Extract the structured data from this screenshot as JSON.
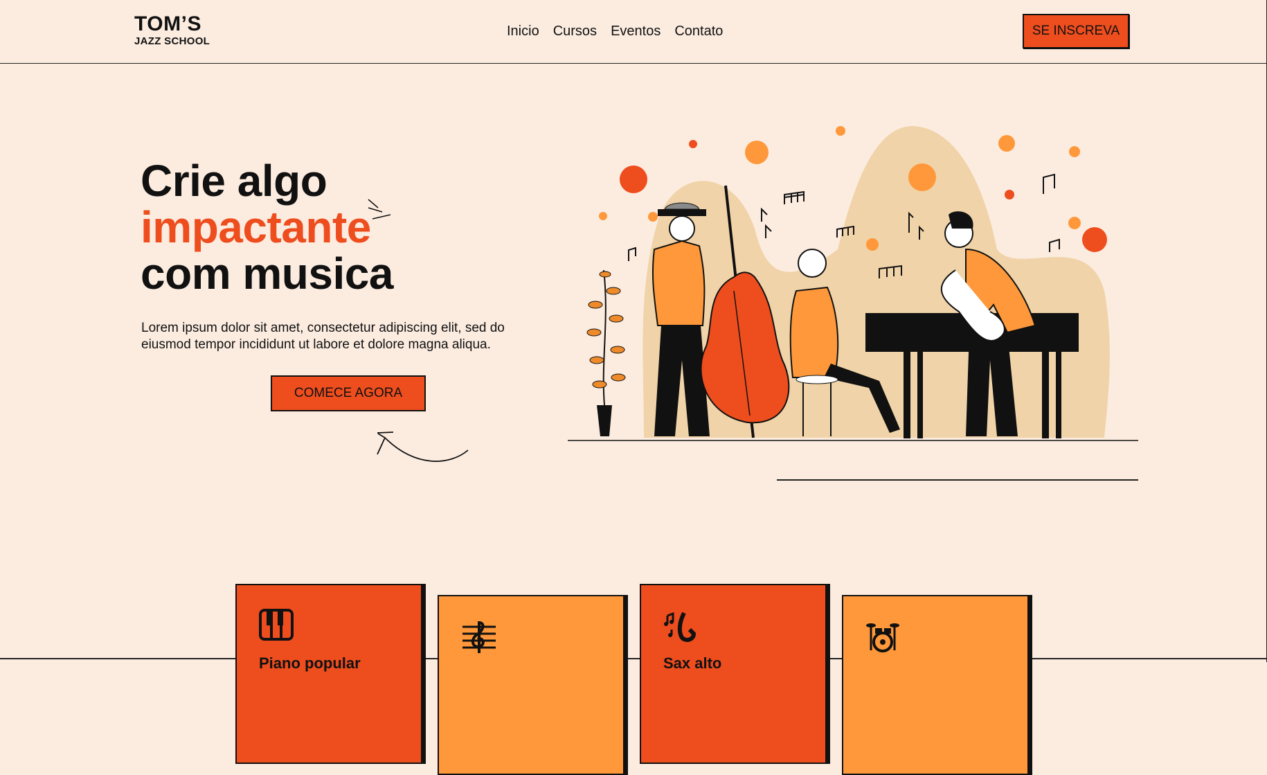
{
  "brand": {
    "title": "TOM’S",
    "subtitle": "JAZZ SCHOOL"
  },
  "nav": {
    "items": [
      "Inicio",
      "Cursos",
      "Eventos",
      "Contato"
    ]
  },
  "header": {
    "signup_label": "SE INSCREVA"
  },
  "hero": {
    "title_line1": "Crie algo",
    "title_line2": "impactante",
    "title_line3": "com musica",
    "description": "Lorem ipsum dolor sit amet, consectetur adipiscing elit, sed do eiusmod tempor incididunt ut labore et dolore magna aliqua.",
    "cta_label": "COMECE AGORA"
  },
  "cards": [
    {
      "label": "Piano popular",
      "icon": "piano-icon",
      "color": "#ee4d1e"
    },
    {
      "label": "",
      "icon": "treble-clef-icon",
      "color": "#fe983a"
    },
    {
      "label": "Sax alto",
      "icon": "saxophone-icon",
      "color": "#ee4d1e"
    },
    {
      "label": "",
      "icon": "drum-kit-icon",
      "color": "#fe983a"
    }
  ],
  "colors": {
    "background": "#fcece0",
    "accent": "#ee4d1e",
    "accent_light": "#fe983a",
    "blob": "#f0d3a8"
  }
}
